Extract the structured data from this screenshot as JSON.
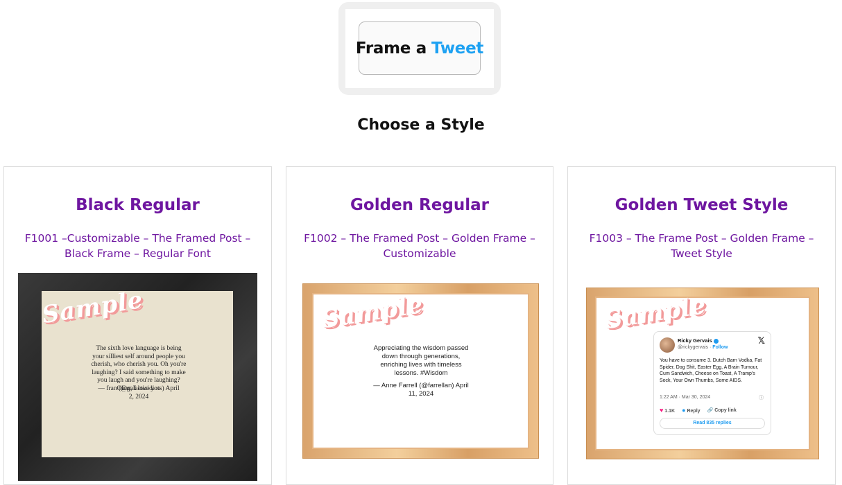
{
  "logo": {
    "word1": "Frame a",
    "word2": "Tweet"
  },
  "page_title": "Choose a Style",
  "cards": [
    {
      "title": "Black Regular",
      "subtitle": "F1001 –Customizable – The Framed Post – Black Frame – Regular Font",
      "watermark": "Sample",
      "quote": "The sixth love language is being your silliest self around people you cherish, who cherish you. Oh you're laughing? I said something to make you laugh and you're laughing? Okay, I love you",
      "attribution": "— fran (@galacticidiots) April 2, 2024"
    },
    {
      "title": "Golden Regular",
      "subtitle": "F1002 – The Framed Post – Golden Frame – Customizable",
      "watermark": "Sample",
      "quote": "Appreciating the wisdom passed down through generations, enriching lives with timeless lessons. #Wisdom",
      "attribution": "— Anne Farrell (@farrellan) April 11, 2024"
    },
    {
      "title": "Golden Tweet Style",
      "subtitle": "F1003 – The Frame Post – Golden Frame – Tweet Style",
      "watermark": "Sample",
      "tweet": {
        "name": "Ricky Gervais",
        "handle": "@rickygervais",
        "follow": "Follow",
        "x_logo": "𝕏",
        "body": "You have to consume 3. Dutch Barn Vodka, Fat Spider, Dog Shit, Easter Egg, A Brain Tumour, Cum Sandwich, Cheese on Toast, A Tramp's Sock, Your Own Thumbs, Some AIDS.",
        "time": "1:22 AM · Mar 30, 2024",
        "likes": "1.1K",
        "reply": "Reply",
        "copy": "Copy link",
        "read": "Read 835 replies"
      }
    }
  ]
}
